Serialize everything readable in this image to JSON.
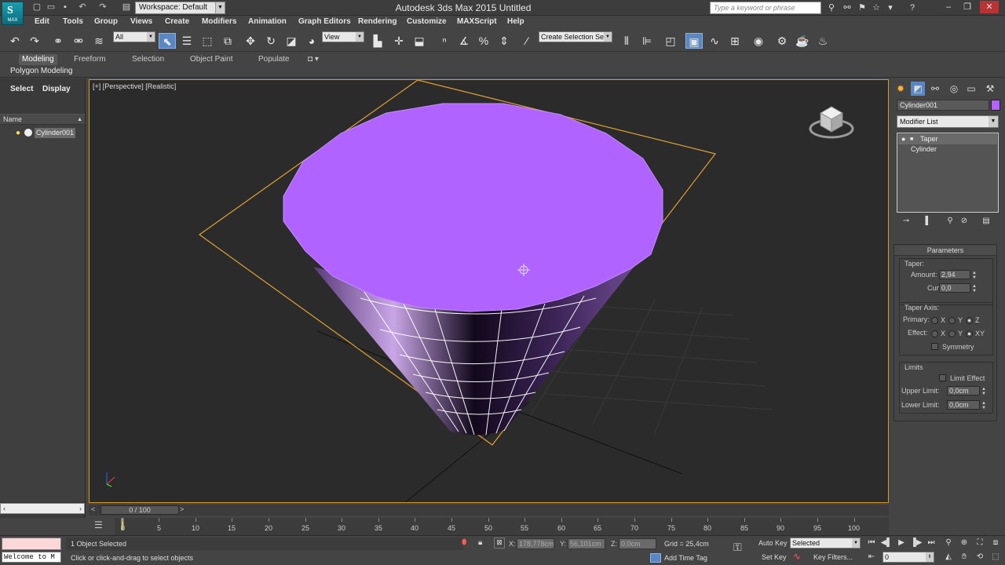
{
  "titlebar": {
    "title": "Autodesk 3ds Max  2015     Untitled",
    "workspace": "Workspace: Default",
    "search_placeholder": "Type a keyword or phrase",
    "logo_text": "MAX",
    "logo_glyph": "S"
  },
  "menus": [
    "Edit",
    "Tools",
    "Group",
    "Views",
    "Create",
    "Modifiers",
    "Animation",
    "Graph Editors",
    "Rendering",
    "Customize",
    "MAXScript",
    "Help"
  ],
  "toolbar": {
    "selection_filter": "All",
    "ref_coord": "View",
    "named_selection": "Create Selection Se"
  },
  "ribbon": {
    "tabs": [
      "Modeling",
      "Freeform",
      "Selection",
      "Object Paint",
      "Populate"
    ],
    "panel_label": "Polygon Modeling"
  },
  "explorer": {
    "select_label": "Select",
    "display_label": "Display",
    "column_header": "Name",
    "items": [
      {
        "label": "Cylinder001"
      }
    ]
  },
  "viewport": {
    "label": "[+] [Perspective] [Realistic]",
    "object_color": "#b063ff",
    "selection_color": "#e0a030"
  },
  "command_panel": {
    "object_name": "Cylinder001",
    "object_color": "#b560ff",
    "modifier_list": "Modifier List",
    "stack": [
      "Taper",
      "Cylinder"
    ],
    "parameters": {
      "title": "Parameters",
      "taper_label": "Taper:",
      "amount_label": "Amount:",
      "amount": "2,94",
      "curve_label": "Curve:",
      "curve": "0,0",
      "axis_label": "Taper Axis:",
      "primary_label": "Primary:",
      "effect_label": "Effect:",
      "axis_x": "X",
      "axis_y": "Y",
      "axis_z": "Z",
      "axis_xy": "XY",
      "symmetry_label": "Symmetry",
      "limits_label": "Limits",
      "limit_effect_label": "Limit Effect",
      "upper_label": "Upper Limit:",
      "upper": "0,0cm",
      "lower_label": "Lower Limit:",
      "lower": "0,0cm"
    }
  },
  "timeline": {
    "frame": "0 / 100",
    "ticks": [
      "0",
      "5",
      "10",
      "15",
      "20",
      "25",
      "30",
      "35",
      "40",
      "45",
      "50",
      "55",
      "60",
      "65",
      "70",
      "75",
      "80",
      "85",
      "90",
      "95",
      "100"
    ]
  },
  "status": {
    "welcome": "Welcome to M",
    "selection_count": "1 Object Selected",
    "prompt": "Click or click-and-drag to select objects",
    "x_label": "X:",
    "x": "178,778cm",
    "y_label": "Y:",
    "y": "56,101cm",
    "z_label": "Z:",
    "z": "0,0cm",
    "grid": "Grid = 25,4cm",
    "add_time_tag": "Add Time Tag",
    "auto_key": "Auto Key",
    "set_key": "Set Key",
    "key_mode": "Selected",
    "key_filters": "Key Filters...",
    "current_frame": "0"
  }
}
